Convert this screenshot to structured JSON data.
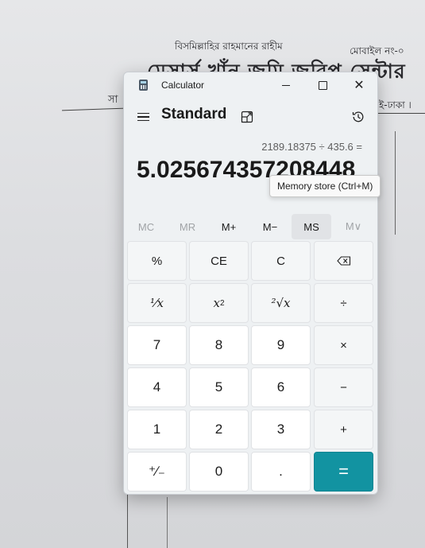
{
  "background_document": {
    "line1": "বিসমিল্লাহির রাহমানের রাহীম",
    "line2": "মোবাইল নং-০",
    "line3": "মেসার্স খাঁন জমি জরিপ সেন্টার",
    "line4": "সা",
    "line5": "ই-ঢাকা ।"
  },
  "window": {
    "title": "Calculator",
    "minimize_label": "—",
    "maximize_label": "□",
    "close_label": "✕"
  },
  "header": {
    "mode": "Standard"
  },
  "display": {
    "expression": "2189.18375 ÷ 435.6 =",
    "result": "5.025674357208448"
  },
  "tooltip": "Memory store (Ctrl+M)",
  "memory": {
    "mc": "MC",
    "mr": "MR",
    "mplus": "M+",
    "mminus": "M−",
    "ms": "MS",
    "mlist": "M∨"
  },
  "keys": {
    "percent": "%",
    "ce": "CE",
    "c": "C",
    "backspace": "⌫",
    "reciprocal": "¹⁄x",
    "square": "x",
    "square_sup": "2",
    "sqrt": "²√x",
    "divide": "÷",
    "seven": "7",
    "eight": "8",
    "nine": "9",
    "multiply": "×",
    "four": "4",
    "five": "5",
    "six": "6",
    "minus": "−",
    "one": "1",
    "two": "2",
    "three": "3",
    "plus": "+",
    "negate": "⁺∕₋",
    "zero": "0",
    "decimal": ".",
    "equals": "="
  },
  "colors": {
    "accent": "#1293a1",
    "window_bg": "#eef1f3"
  }
}
